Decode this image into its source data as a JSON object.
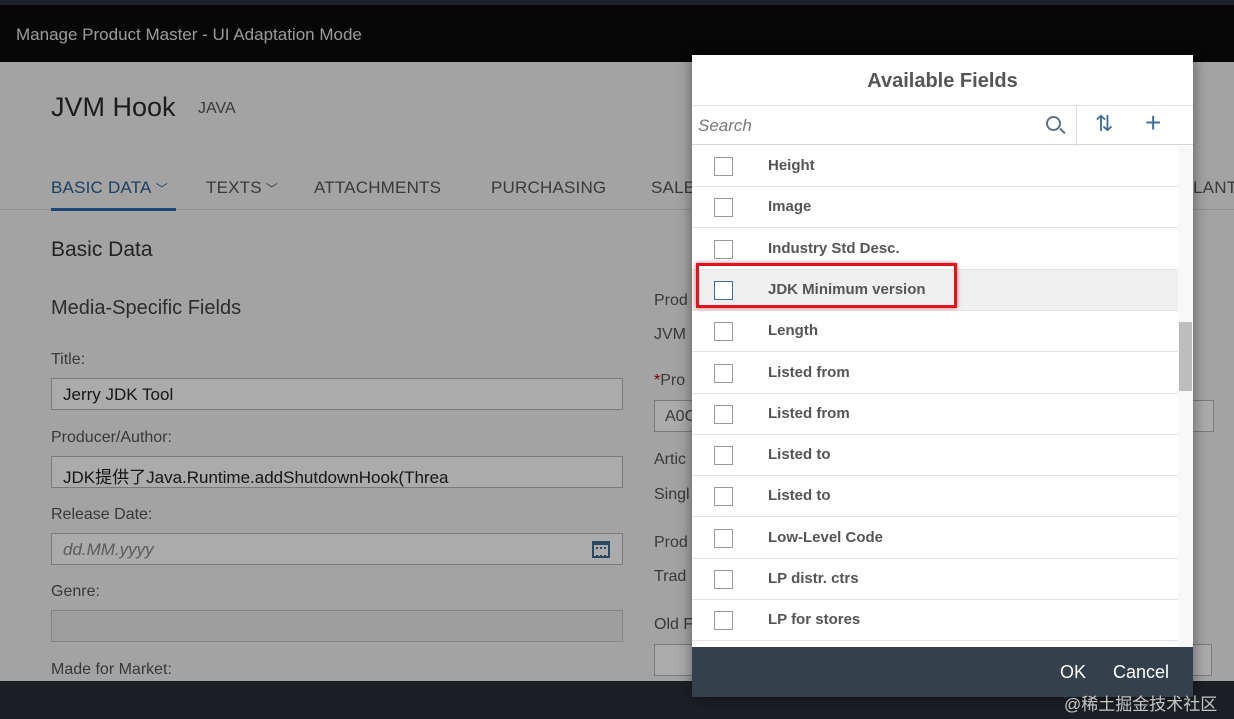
{
  "shell": {
    "title": "Manage Product Master  - UI Adaptation Mode"
  },
  "object": {
    "title": "JVM Hook",
    "subtitle": "JAVA"
  },
  "tabs": [
    {
      "label": "BASIC DATA",
      "chevron": true
    },
    {
      "label": "TEXTS",
      "chevron": true
    },
    {
      "label": "ATTACHMENTS",
      "chevron": false
    },
    {
      "label": "PURCHASING",
      "chevron": false
    },
    {
      "label": "SALE",
      "chevron": false
    },
    {
      "label": "LANT",
      "chevron": false
    }
  ],
  "form": {
    "section_title": "Basic Data",
    "group_title": "Media-Specific Fields",
    "title_label": "Title:",
    "title_value": "Jerry JDK Tool",
    "producer_label": "Producer/Author:",
    "producer_value": "JDK提供了Java.Runtime.addShutdownHook(Threa",
    "release_label": "Release Date:",
    "release_placeholder": "dd.MM.yyyy",
    "genre_label": "Genre:",
    "market_label": "Made for Market:",
    "right_fragments": [
      "Prod",
      "JVM",
      "Pro",
      "A0C",
      "Artic",
      "Singl",
      "Prod",
      "Trad",
      "Old F"
    ],
    "required_marker": "*"
  },
  "dialog": {
    "title": "Available Fields",
    "search_placeholder": "Search",
    "items": [
      {
        "label": "Height",
        "checked": false,
        "selected": false
      },
      {
        "label": "Image",
        "checked": false,
        "selected": false
      },
      {
        "label": "Industry Std Desc.",
        "checked": false,
        "selected": false
      },
      {
        "label": "JDK Minimum version",
        "checked": false,
        "selected": true
      },
      {
        "label": "Length",
        "checked": false,
        "selected": false
      },
      {
        "label": "Listed from",
        "checked": false,
        "selected": false
      },
      {
        "label": "Listed from",
        "checked": false,
        "selected": false
      },
      {
        "label": "Listed to",
        "checked": false,
        "selected": false
      },
      {
        "label": "Listed to",
        "checked": false,
        "selected": false
      },
      {
        "label": "Low-Level Code",
        "checked": false,
        "selected": false
      },
      {
        "label": "LP distr. ctrs",
        "checked": false,
        "selected": false
      },
      {
        "label": "LP for stores",
        "checked": false,
        "selected": false
      }
    ],
    "ok_label": "OK",
    "cancel_label": "Cancel"
  },
  "icons": {
    "search": "search-icon",
    "sort": "sort-icon",
    "add": "add-icon",
    "calendar": "calendar-icon"
  },
  "watermark": "@稀土掘金技术社区",
  "colors": {
    "accent": "#3d6d99",
    "highlight": "#e0141e",
    "shell": "#0b0b0b",
    "footer": "#34404c"
  }
}
